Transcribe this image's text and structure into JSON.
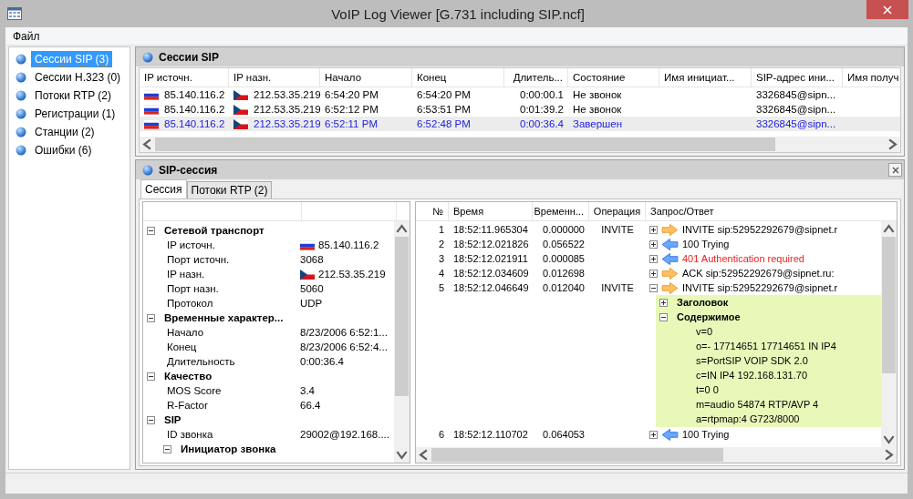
{
  "window": {
    "title": "VoIP Log Viewer [G.731 including SIP.ncf]"
  },
  "menu": [
    {
      "label": "Файл"
    }
  ],
  "sidebar": {
    "items": [
      {
        "label": "Сессии SIP  (3)",
        "selected": true
      },
      {
        "label": "Сессии H.323 (0)",
        "selected": false
      },
      {
        "label": "Потоки RTP (2)",
        "selected": false
      },
      {
        "label": "Регистрации (1)",
        "selected": false
      },
      {
        "label": "Станции (2)",
        "selected": false
      },
      {
        "label": "Ошибки (6)",
        "selected": false
      }
    ]
  },
  "sessions_panel": {
    "title": "Сессии SIP",
    "table": {
      "columns": [
        "IP источн.",
        "IP назн.",
        "Начало",
        "Конец",
        "Длитель...",
        "Состояние",
        "Имя инициат...",
        "SIP-адрес ини...",
        "Имя получ"
      ],
      "rows": [
        {
          "selected": false,
          "cells": [
            "85.140.116.2",
            "212.53.35.219",
            "6:54:20 PM",
            "6:54:20 PM",
            "0:00:00.1",
            "Не звонок",
            "",
            "3326845@sipn...",
            ""
          ]
        },
        {
          "selected": false,
          "cells": [
            "85.140.116.2",
            "212.53.35.219",
            "6:52:12 PM",
            "6:53:51 PM",
            "0:01:39.2",
            "Не звонок",
            "",
            "3326845@sipn...",
            ""
          ]
        },
        {
          "selected": true,
          "cells": [
            "85.140.116.2",
            "212.53.35.219",
            "6:52:11 PM",
            "6:52:48 PM",
            "0:00:36.4",
            "Завершен",
            "",
            "3326845@sipn...",
            ""
          ]
        }
      ]
    }
  },
  "session_panel": {
    "title": "SIP-сессия",
    "tabs": [
      {
        "label": "Сессия",
        "selected": true
      },
      {
        "label": "Потоки RTP (2)",
        "selected": false
      }
    ],
    "properties": [
      {
        "label": "Сетевой транспорт",
        "expanded": true,
        "children": [
          {
            "label": "IP источн.",
            "value": "85.140.116.2",
            "kind": "ip_ru"
          },
          {
            "label": "Порт источн.",
            "value": "3068"
          },
          {
            "label": "IP назн.",
            "value": "212.53.35.219",
            "kind": "ip_cz"
          },
          {
            "label": "Порт назн.",
            "value": "5060"
          },
          {
            "label": "Протокол",
            "value": "UDP"
          }
        ]
      },
      {
        "label": "Временные характер...",
        "expanded": true,
        "children": [
          {
            "label": "Начало",
            "value": "8/23/2006 6:52:1..."
          },
          {
            "label": "Конец",
            "value": "8/23/2006 6:52:4..."
          },
          {
            "label": "Длительность",
            "value": "0:00:36.4"
          }
        ]
      },
      {
        "label": "Качество",
        "expanded": true,
        "children": [
          {
            "label": "MOS Score",
            "value": "3.4"
          },
          {
            "label": "R-Factor",
            "value": "66.4"
          }
        ]
      },
      {
        "label": "SIP",
        "expanded": true,
        "children": [
          {
            "label": "ID звонка",
            "value": "29002@192.168...."
          },
          {
            "label": "Инициатор звонка",
            "expanded": true
          }
        ]
      }
    ],
    "messages": {
      "columns": [
        "№",
        "Время",
        "Временн...",
        "Операция",
        "Запрос/Ответ"
      ],
      "rows": [
        {
          "number": "1",
          "time": "18:52:11.965304",
          "delta": "0.000000",
          "operation": "INVITE",
          "kind": "outgoing",
          "expanded": false,
          "error": false,
          "message": "INVITE sip:52952292679@sipnet.r"
        },
        {
          "number": "2",
          "time": "18:52:12.021826",
          "delta": "0.056522",
          "operation": "",
          "kind": "incoming",
          "expanded": false,
          "error": false,
          "message": "100 Trying"
        },
        {
          "number": "3",
          "time": "18:52:12.021911",
          "delta": "0.000085",
          "operation": "",
          "kind": "incoming",
          "expanded": false,
          "error": true,
          "message": "401 Authentication required"
        },
        {
          "number": "4",
          "time": "18:52:12.034609",
          "delta": "0.012698",
          "operation": "",
          "kind": "outgoing",
          "expanded": false,
          "error": false,
          "message": "ACK sip:52952292679@sipnet.ru:"
        },
        {
          "number": "5",
          "time": "18:52:12.046649",
          "delta": "0.012040",
          "operation": "INVITE",
          "kind": "outgoing",
          "expanded": true,
          "error": false,
          "message": "INVITE sip:52952292679@sipnet.r",
          "details": [
            {
              "label": "Заголовок",
              "expanded": false
            },
            {
              "label": "Содержимое",
              "expanded": true,
              "lines": [
                "v=0",
                "o=- 17714651 17714651 IN IP4",
                "s=PortSIP VOIP SDK 2.0",
                "c=IN IP4 192.168.131.70",
                "t=0 0",
                "m=audio 54874 RTP/AVP 4",
                "a=rtpmap:4 G723/8000"
              ]
            }
          ]
        },
        {
          "number": "6",
          "time": "18:52:12.110702",
          "delta": "0.064053",
          "operation": "",
          "kind": "incoming",
          "expanded": false,
          "error": false,
          "message": "100 Trying"
        }
      ]
    }
  }
}
